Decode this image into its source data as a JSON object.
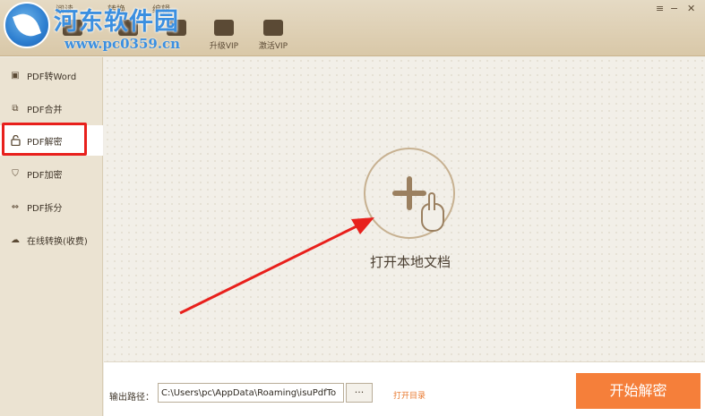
{
  "watermark": {
    "site_name": "河东软件园",
    "url": "www.pc0359.cn"
  },
  "top_tabs": [
    "阅读",
    "转换",
    "编辑"
  ],
  "toolbar": [
    {
      "label": "",
      "icon": "folder-icon"
    },
    {
      "label": "",
      "icon": "document-icon"
    },
    {
      "label": "",
      "icon": "chat-icon"
    },
    {
      "label": "升级VIP",
      "icon": "crown-icon"
    },
    {
      "label": "激活VIP",
      "icon": "user-key-icon"
    }
  ],
  "window_controls": {
    "menu": "≡",
    "minimize": "−",
    "close": "✕"
  },
  "sidebar": {
    "items": [
      {
        "label": "PDF转Word",
        "icon": "word-convert-icon",
        "glyph": "▣"
      },
      {
        "label": "PDF合并",
        "icon": "merge-icon",
        "glyph": "⧉"
      },
      {
        "label": "PDF解密",
        "icon": "unlock-icon",
        "glyph": "🔓",
        "active": true
      },
      {
        "label": "PDF加密",
        "icon": "shield-icon",
        "glyph": "⛉"
      },
      {
        "label": "PDF拆分",
        "icon": "split-icon",
        "glyph": "⇔"
      },
      {
        "label": "在线转换(收费)",
        "icon": "cloud-icon",
        "glyph": "☁"
      }
    ]
  },
  "main": {
    "open_label": "打开本地文档"
  },
  "bottom": {
    "output_label": "输出路径：",
    "output_path": "C:\\Users\\pc\\AppData\\Roaming\\isuPdfTo",
    "browse_label": "···",
    "open_dir_label": "打开目录",
    "start_label": "开始解密"
  },
  "colors": {
    "accent": "#f57f3a",
    "highlight": "#e8201c",
    "arrow": "#e8201c"
  }
}
